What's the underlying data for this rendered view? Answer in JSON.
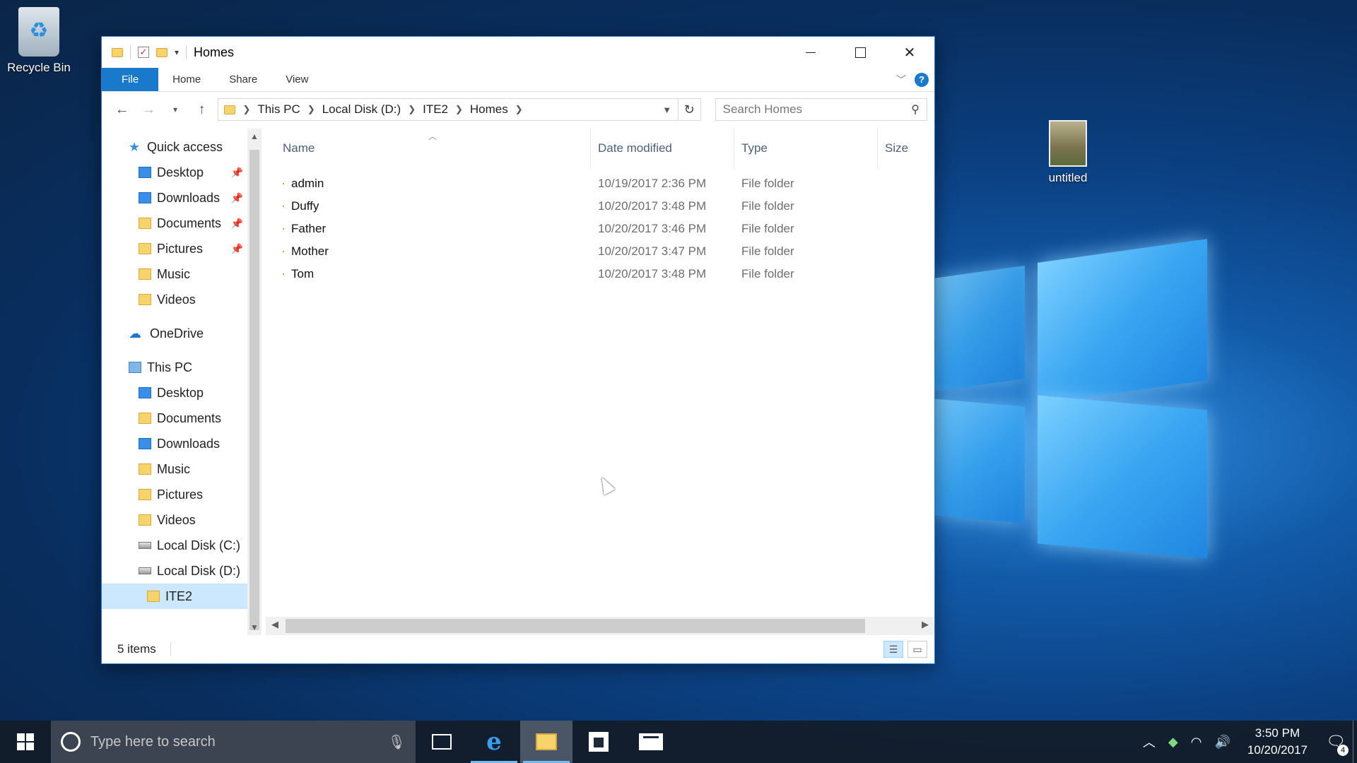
{
  "desktop": {
    "recycle_bin_label": "Recycle Bin",
    "photo_label": "untitled"
  },
  "window": {
    "title": "Homes",
    "ribbon_tabs": [
      "File",
      "Home",
      "Share",
      "View"
    ],
    "help_label": "?",
    "breadcrumb": [
      "This PC",
      "Local Disk (D:)",
      "ITE2",
      "Homes"
    ],
    "search_placeholder": "Search Homes",
    "nav": {
      "quick_access": "Quick access",
      "quick_items": [
        "Desktop",
        "Downloads",
        "Documents",
        "Pictures",
        "Music",
        "Videos"
      ],
      "onedrive": "OneDrive",
      "this_pc": "This PC",
      "pc_items": [
        "Desktop",
        "Documents",
        "Downloads",
        "Music",
        "Pictures",
        "Videos"
      ],
      "disk_c": "Local Disk (C:)",
      "disk_d": "Local Disk (D:)",
      "ite2": "ITE2"
    },
    "columns": {
      "name": "Name",
      "date": "Date modified",
      "type": "Type",
      "size": "Size"
    },
    "files": [
      {
        "name": "admin",
        "date": "10/19/2017 2:36 PM",
        "type": "File folder"
      },
      {
        "name": "Duffy",
        "date": "10/20/2017 3:48 PM",
        "type": "File folder"
      },
      {
        "name": "Father",
        "date": "10/20/2017 3:46 PM",
        "type": "File folder"
      },
      {
        "name": "Mother",
        "date": "10/20/2017 3:47 PM",
        "type": "File folder"
      },
      {
        "name": "Tom",
        "date": "10/20/2017 3:48 PM",
        "type": "File folder"
      }
    ],
    "status": "5 items"
  },
  "taskbar": {
    "search_placeholder": "Type here to search",
    "time": "3:50 PM",
    "date": "10/20/2017",
    "notification_count": "4"
  },
  "colors": {
    "accent": "#1979ca",
    "selection": "#cce8ff",
    "folder": "#f7d36b"
  }
}
